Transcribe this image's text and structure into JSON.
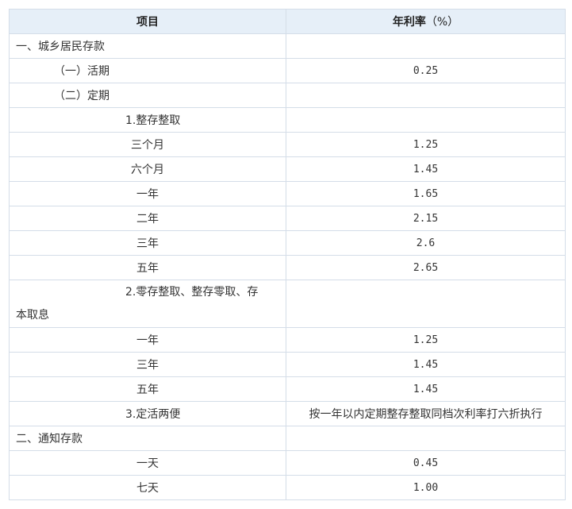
{
  "header": {
    "item": "项目",
    "rate": "年利率",
    "unit": "（%）"
  },
  "sections": {
    "urban_rural": "一、城乡居民存款",
    "demand": "（一）活期",
    "demand_rate": "0.25",
    "time": "（二）定期",
    "lump": "1.整存整取",
    "lump_rows": [
      {
        "term": "三个月",
        "rate": "1.25"
      },
      {
        "term": "六个月",
        "rate": "1.45"
      },
      {
        "term": "一年",
        "rate": "1.65"
      },
      {
        "term": "二年",
        "rate": "2.15"
      },
      {
        "term": "三年",
        "rate": "2.6"
      },
      {
        "term": "五年",
        "rate": "2.65"
      }
    ],
    "installment_line1": "2.零存整取、整存零取、存",
    "installment_line2": "本取息",
    "installment_rows": [
      {
        "term": "一年",
        "rate": "1.25"
      },
      {
        "term": "三年",
        "rate": "1.45"
      },
      {
        "term": "五年",
        "rate": "1.45"
      }
    ],
    "flex": "3.定活两便",
    "flex_rate": "按一年以内定期整存整取同档次利率打六折执行",
    "notice": "二、通知存款",
    "notice_rows": [
      {
        "term": "一天",
        "rate": "0.45"
      },
      {
        "term": "七天",
        "rate": "1.00"
      }
    ]
  }
}
